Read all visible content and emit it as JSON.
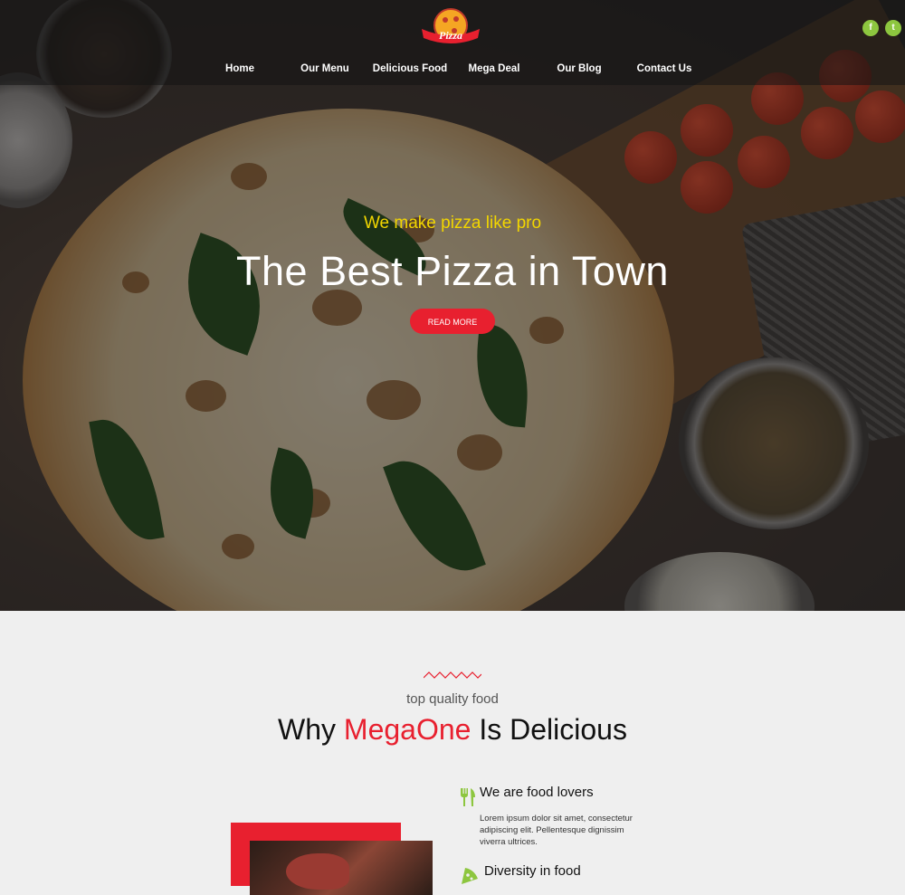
{
  "header": {
    "logo_text": "Pizza",
    "nav": [
      "Home",
      "Our Menu",
      "Delicious Food",
      "Mega Deal",
      "Our Blog",
      "Contact Us"
    ],
    "social": [
      {
        "name": "facebook-icon",
        "glyph": "f"
      },
      {
        "name": "twitter-icon",
        "glyph": "t"
      }
    ]
  },
  "hero": {
    "tagline": "We make pizza like pro",
    "title": "The Best Pizza in Town",
    "button": "READ MORE"
  },
  "why": {
    "subheading": "top quality food",
    "title_prefix": "Why ",
    "title_accent": "MegaOne",
    "title_suffix": " Is Delicious",
    "features": [
      {
        "icon": "fork-knife-icon",
        "title": "We are food lovers",
        "text": "Lorem ipsum dolor sit amet, consectetur adipiscing elit. Pellentesque dignissim viverra ultrices."
      },
      {
        "icon": "pizza-slice-icon",
        "title": "Diversity in food",
        "text": ""
      }
    ]
  },
  "colors": {
    "accent_red": "#e8202f",
    "accent_yellow": "#f2d600",
    "social_green": "#8dc63f",
    "icon_green": "#8dc63f"
  }
}
